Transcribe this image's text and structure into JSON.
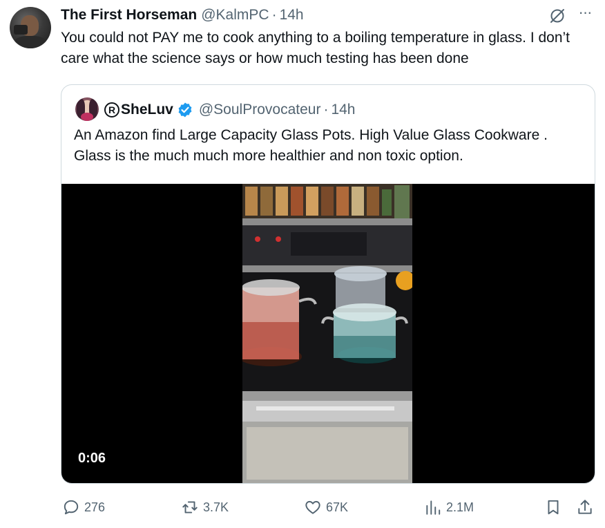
{
  "tweet": {
    "author_name": "The First Horseman",
    "author_handle": "@KalmPC",
    "separator": "·",
    "time": "14h",
    "text": "You could not PAY me to cook anything to a boiling temperature in glass. I don’t care what the science says or how much testing has been done"
  },
  "quoted": {
    "author_name": "SheLuv",
    "registered_mark": "R",
    "author_handle": "@SoulProvocateur",
    "separator": "·",
    "time": "14h",
    "text": "An Amazon find Large Capacity Glass Pots. High Value Glass Cookware . Glass is the much much more healthier and non toxic option.",
    "video_duration": "0:06"
  },
  "actions": {
    "replies": "276",
    "reposts": "3.7K",
    "likes": "67K",
    "views": "2.1M"
  },
  "colors": {
    "text_primary": "#0f1419",
    "text_secondary": "#536471",
    "border": "#cfd9de",
    "verified_blue": "#1d9bf0"
  }
}
